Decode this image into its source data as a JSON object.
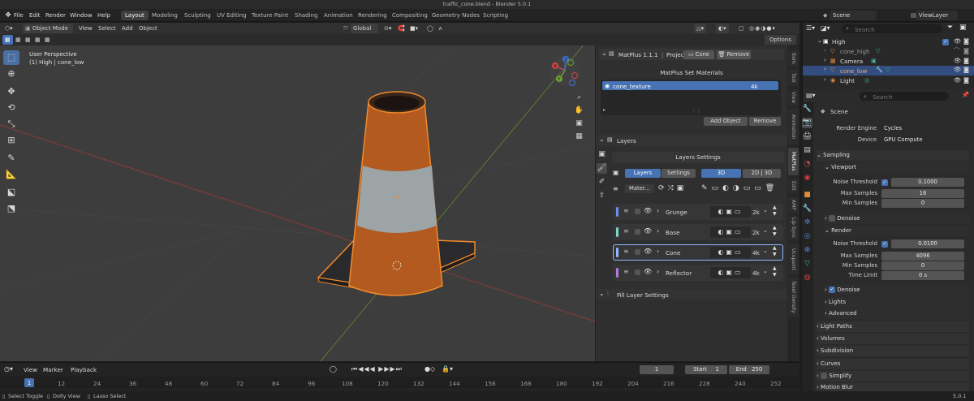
{
  "window_title": "traffic_cone.blend - Blender 5.0.1",
  "menu": [
    "File",
    "Edit",
    "Render",
    "Window",
    "Help"
  ],
  "workspaces": [
    "Layout",
    "Modeling",
    "Sculpting",
    "UV Editing",
    "Texture Paint",
    "Shading",
    "Animation",
    "Rendering",
    "Compositing",
    "Geometry Nodes",
    "Scripting"
  ],
  "scene_field": "Scene",
  "viewlayer_field": "ViewLayer",
  "header": {
    "mode": "Object Mode",
    "view": "View",
    "select": "Select",
    "add": "Add",
    "object": "Object",
    "orientation": "Global",
    "options": "Options"
  },
  "viewport": {
    "perspective": "User Perspective",
    "collection_info": "(1) High | cone_low",
    "gizmo_axes": [
      "X",
      "Y",
      "Z"
    ]
  },
  "matplus": {
    "title": "MatPlus 1.1.1",
    "project_label": "Project:",
    "cone_btn": "Cone",
    "remove_btn": "Remove",
    "set_materials": "MatPlus Set Materials",
    "material_item": "cone_texture",
    "material_res": "4k",
    "add_object": "Add Object",
    "remove_object": "Remove"
  },
  "layers": {
    "panel_title": "Layers",
    "settings_title": "Layers Settings",
    "tab_layers": "Layers",
    "tab_settings": "Settings",
    "btn_3d": "3D",
    "btn_2d3d": "2D | 3D",
    "material_dropdown": "Mater...",
    "rows": [
      {
        "name": "Grunge",
        "res": "2k",
        "color": "#6f8ff0"
      },
      {
        "name": "Base",
        "res": "2k",
        "color": "#7ad7c8"
      },
      {
        "name": "Cone",
        "res": "4k",
        "color": "#8fb8ff"
      },
      {
        "name": "Reflector",
        "res": "4k",
        "color": "#b07ae0"
      }
    ],
    "fill_settings": "Fill Layer Settings"
  },
  "ntabs": [
    "Item",
    "Tool",
    "View",
    "Animation",
    "MatPlus",
    "Edit",
    "AMP",
    "Lip Sync",
    "Ucupaint",
    "Texel Density"
  ],
  "outliner": {
    "search_placeholder": "Search",
    "items": [
      {
        "name": "High"
      },
      {
        "name": "cone_high"
      },
      {
        "name": "Camera"
      },
      {
        "name": "cone_low"
      },
      {
        "name": "Light"
      }
    ]
  },
  "properties": {
    "search_placeholder": "Search",
    "scene": "Scene",
    "render_engine_label": "Render Engine",
    "render_engine": "Cycles",
    "device_label": "Device",
    "device": "GPU Compute",
    "sampling": "Sampling",
    "viewport": "Viewport",
    "noise_threshold_label": "Noise Threshold",
    "viewport_noise": "0.1000",
    "max_samples_label": "Max Samples",
    "viewport_max": "16",
    "min_samples_label": "Min Samples",
    "viewport_min": "0",
    "denoise": "Denoise",
    "render": "Render",
    "render_noise": "0.0100",
    "render_max": "4096",
    "render_min": "0",
    "time_limit_label": "Time Limit",
    "time_limit": "0 s",
    "lights": "Lights",
    "advanced": "Advanced",
    "light_paths": "Light Paths",
    "volumes": "Volumes",
    "subdivision": "Subdivision",
    "curves": "Curves",
    "simplify": "Simplify",
    "motion_blur": "Motion Blur"
  },
  "timeline": {
    "view": "View",
    "marker": "Marker",
    "playback": "Playback",
    "current_frame": "1",
    "start_label": "Start",
    "start": "1",
    "end_label": "End",
    "end": "250",
    "ticks": [
      "1",
      "12",
      "24",
      "36",
      "48",
      "60",
      "72",
      "84",
      "96",
      "108",
      "120",
      "132",
      "144",
      "156",
      "168",
      "180",
      "192",
      "204",
      "216",
      "228",
      "240",
      "252"
    ]
  },
  "status": {
    "select_toggle": "Select Toggle",
    "dolly_view": "Dolly View",
    "lasso_select": "Lasso Select",
    "version": "5.0.1"
  }
}
